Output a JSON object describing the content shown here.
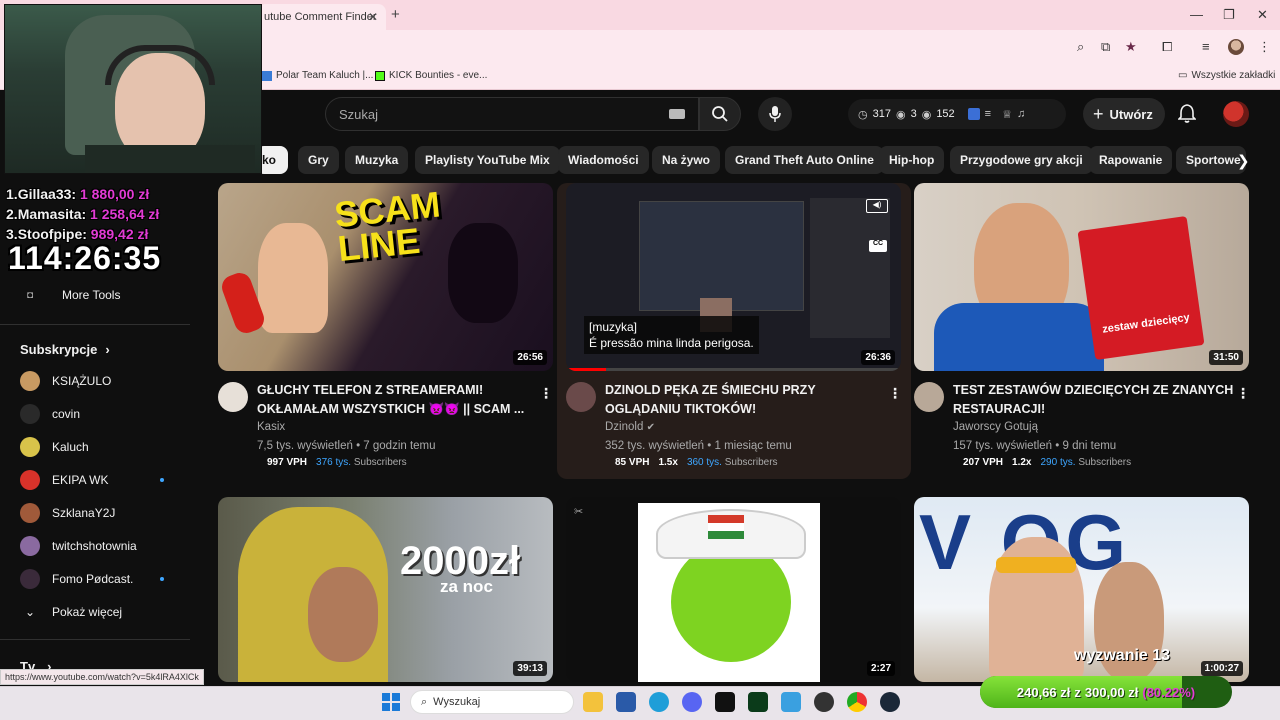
{
  "browser": {
    "tab_title": "utube Comment Finder",
    "bookmarks": [
      {
        "label": "Polar Team Kaluch |..."
      },
      {
        "label": "KICK Bounties - eve..."
      }
    ],
    "all_bookmarks": "Wszystkie zakładki",
    "status_url": "https://www.youtube.com/watch?v=5k4lRA4XlCk"
  },
  "youtube": {
    "search_placeholder": "Szukaj",
    "ext_stats": {
      "clock": "317",
      "views_a": "3",
      "views_b": "152"
    },
    "create_label": "Utwórz",
    "chips": [
      "ko",
      "Gry",
      "Muzyka",
      "Playlisty YouTube Mix",
      "Wiadomości",
      "Na żywo",
      "Grand Theft Auto Online",
      "Hip-hop",
      "Przygodowe gry akcji",
      "Rapowanie",
      "Sportowe"
    ]
  },
  "sidebar": {
    "more_tools": "More Tools",
    "subscriptions_title": "Subskrypcje",
    "channels": [
      {
        "name": "KSIĄŻULO",
        "live": false,
        "color": "#c89a62"
      },
      {
        "name": "covin",
        "live": false,
        "color": "#2a2a2a"
      },
      {
        "name": "Kaluch",
        "live": false,
        "color": "#d8c34a"
      },
      {
        "name": "EKIPA WK",
        "live": true,
        "color": "#d8322a"
      },
      {
        "name": "SzklanaY2J",
        "live": false,
        "color": "#a05a3a"
      },
      {
        "name": "twitchshotownia",
        "live": false,
        "color": "#8a6aa0"
      },
      {
        "name": "Fomo Pødcast.",
        "live": true,
        "color": "#3a2a3a"
      }
    ],
    "show_more": "Pokaż więcej",
    "tv_label": "Tv"
  },
  "videos": [
    {
      "title_line1": "GŁUCHY TELEFON Z STREAMERAMI!",
      "title_line2": "OKŁAMAŁAM WSZYSTKICH 👿👿 || SCAM ...",
      "channel": "Kasix",
      "meta": "7,5 tys. wyświetleń • 7 godzin temu",
      "vph": "997 VPH",
      "mult": "",
      "subs_count": "376 tys.",
      "subs_label": "Subscribers",
      "duration": "26:56",
      "thumb_text": "SCAM LINE"
    },
    {
      "title_line1": "DZINOLD PĘKA ZE ŚMIECHU PRZY",
      "title_line2": "OGLĄDANIU TIKTOKÓW!",
      "channel": "Dzinold",
      "meta": "352 tys. wyświetleń • 1 miesiąc temu",
      "vph": "85 VPH",
      "mult": "1.5x",
      "subs_count": "360 tys.",
      "subs_label": "Subscribers",
      "duration": "26:36",
      "caption_line1": "[muzyka]",
      "caption_line2": "É pressão mina linda perigosa."
    },
    {
      "title_line1": "TEST ZESTAWÓW DZIECIĘCYCH ZE ZNANYCH",
      "title_line2": "RESTAURACJI!",
      "channel": "Jaworscy Gotują",
      "meta": "157 tys. wyświetleń • 9 dni temu",
      "vph": "207 VPH",
      "mult": "1.2x",
      "subs_count": "290 tys.",
      "subs_label": "Subscribers",
      "duration": "31:50",
      "thumb_text": "zestaw dziecięcy"
    },
    {
      "duration": "39:13",
      "thumb_text": "2000zł",
      "thumb_sub": "za noc"
    },
    {
      "duration": "2:27"
    },
    {
      "duration": "1:00:27",
      "thumb_text": "wyzwanie 13"
    }
  ],
  "overlay": {
    "donors": [
      {
        "rank": "1.",
        "name": "Gillaa33:",
        "amount": "1 880,00 zł"
      },
      {
        "rank": "2.",
        "name": "Mamasita:",
        "amount": "1 258,64 zł"
      },
      {
        "rank": "3.",
        "name": "Stoofpipe:",
        "amount": "989,42 zł"
      }
    ],
    "timer": "114:26:35",
    "goal_current": "240,66 zł",
    "goal_sep": "z",
    "goal_target": "300,00 zł",
    "goal_pct_label": "(80.22%)",
    "goal_fraction": 0.8022
  },
  "taskbar": {
    "search_placeholder": "Wyszukaj"
  },
  "colors": {
    "accent_blue": "#3ea6ff",
    "donor_magenta": "#e23bd4",
    "goal_green": "#6cce2a"
  }
}
